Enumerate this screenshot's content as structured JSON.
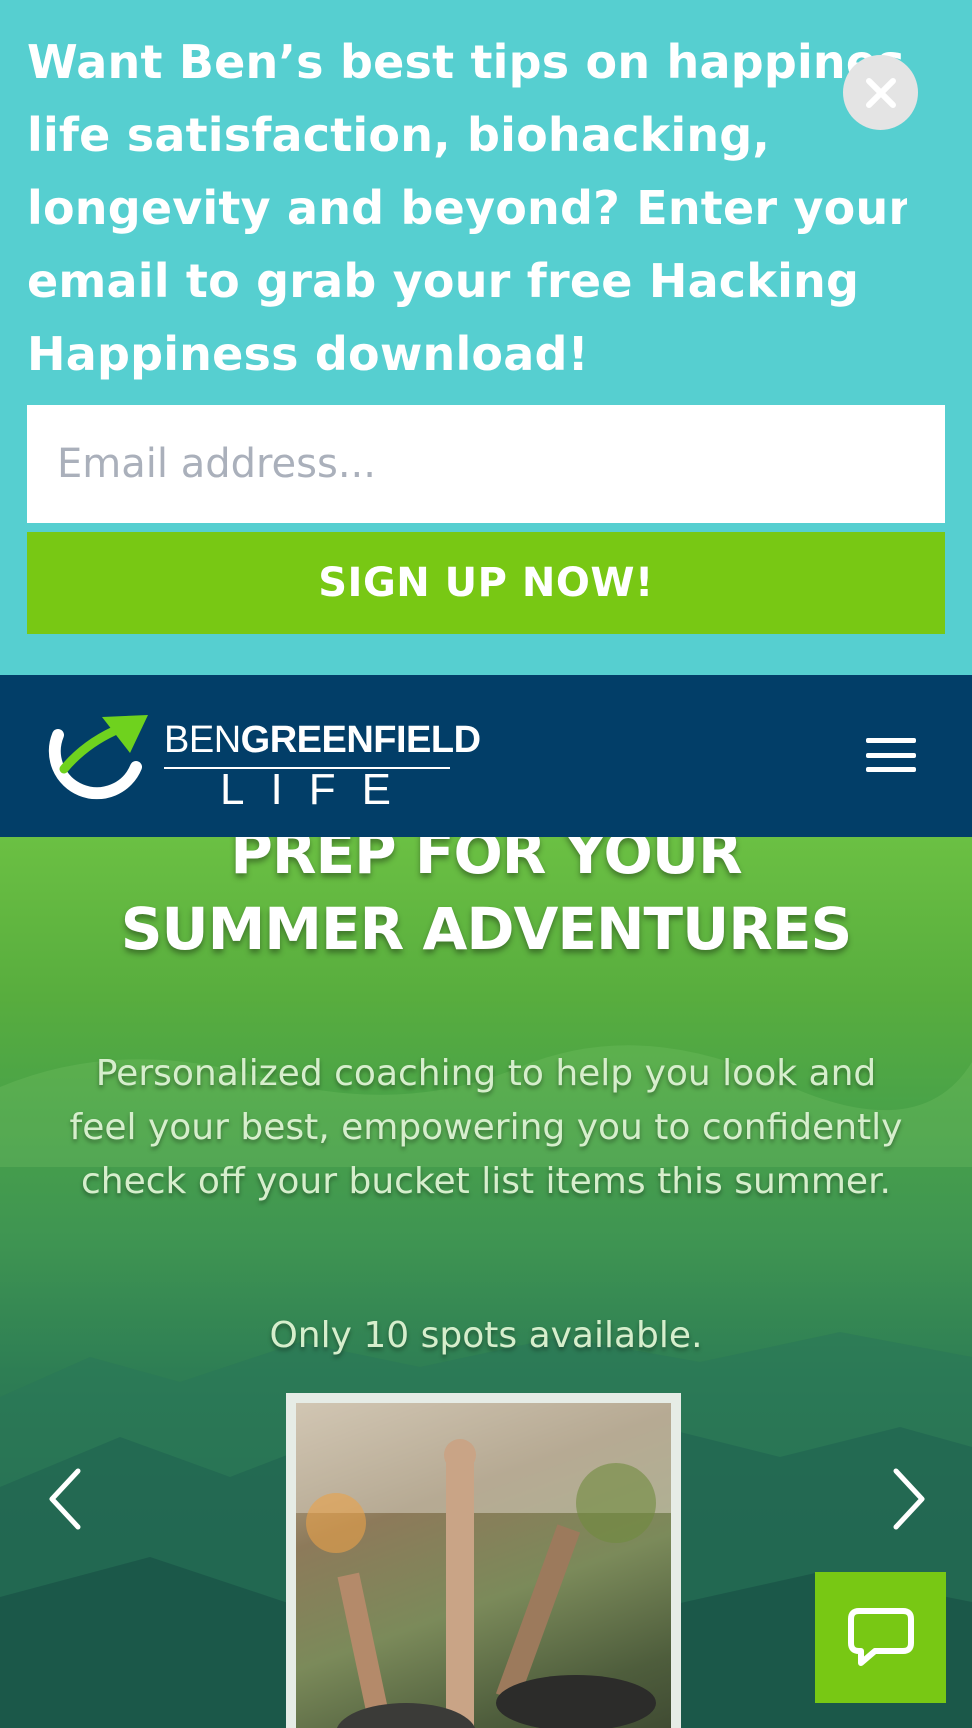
{
  "promo": {
    "text_lines": [
      "Want Ben’s best tips on happiness,",
      "life satisfaction, biohacking,",
      "longevity and beyond? Enter your",
      "email to grab your free Hacking",
      "Happiness download!"
    ],
    "email_placeholder": "Email address...",
    "signup_label": "SIGN UP NOW!"
  },
  "nav": {
    "logo": {
      "name_light": "BEN",
      "name_bold": "GREENFIELD",
      "tagline": "LIFE"
    }
  },
  "hero": {
    "title_lines": [
      "PREP FOR YOUR",
      "SUMMER ADVENTURES"
    ],
    "description": "Personalized coaching to help you look and feel your best, empowering you to confidently check off your bucket list items this summer.",
    "spots": "Only 10 spots available."
  },
  "colors": {
    "promo_bg": "#56cfd0",
    "signup_bg": "#78c814",
    "nav_bg": "#023e68",
    "chat_bg": "#78c814"
  },
  "icons": [
    "close-icon",
    "logo-mark-icon",
    "hamburger-menu-icon",
    "chevron-left-icon",
    "chevron-right-icon",
    "chat-bubble-icon"
  ]
}
